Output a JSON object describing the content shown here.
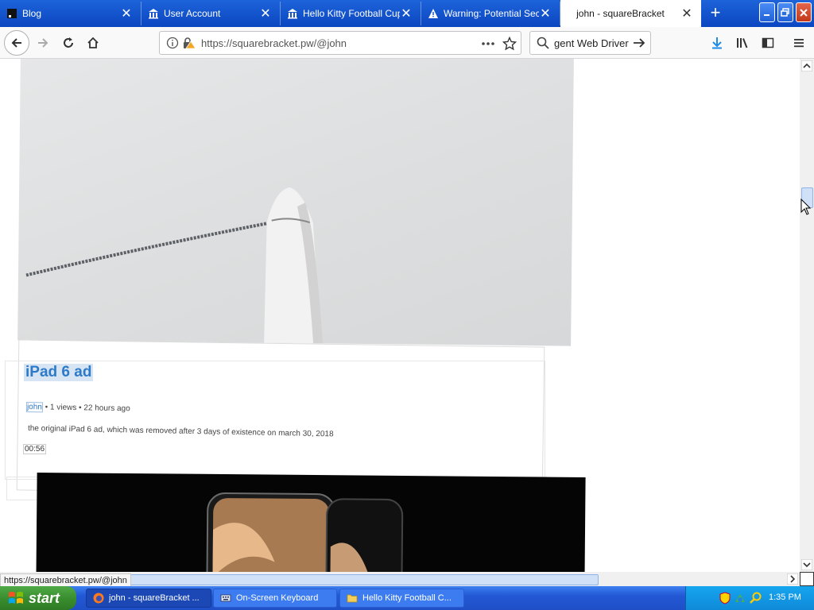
{
  "browser": {
    "tabs": [
      {
        "title": "Blog",
        "icon": "blog-favicon-icon",
        "active": false
      },
      {
        "title": "User Account",
        "icon": "museum-icon",
        "active": false
      },
      {
        "title": "Hello Kitty Football Cup",
        "icon": "museum-icon",
        "active": false
      },
      {
        "title": "Warning: Potential Secu",
        "icon": "warning-icon",
        "active": false
      },
      {
        "title": "john - squareBracket",
        "icon": "",
        "active": true
      }
    ],
    "url": "https://squarebracket.pw/@john",
    "search_text": "gent Web Driver",
    "status_url": "https://squarebracket.pw/@john"
  },
  "content": {
    "video1": {
      "title": "iPad 6 ad",
      "author": "john",
      "meta_rest": " • 1 views • 22 hours ago",
      "description": "the original iPad 6 ad, which was removed after 3  days of existence on march 30, 2018",
      "duration": "00:56"
    }
  },
  "taskbar": {
    "start_label": "start",
    "buttons": [
      {
        "label": "john - squareBracket ...",
        "icon": "firefox-icon",
        "active": true
      },
      {
        "label": "On-Screen Keyboard",
        "icon": "keyboard-icon",
        "active": false
      },
      {
        "label": "Hello Kitty Football C...",
        "icon": "folder-icon",
        "active": false
      }
    ],
    "clock": "1:35 PM"
  },
  "colors": {
    "tab_bar": "#0b46c1",
    "link": "#2d7ac8",
    "start_green": "#3a8e2f",
    "taskbar_blue": "#2358d4"
  }
}
